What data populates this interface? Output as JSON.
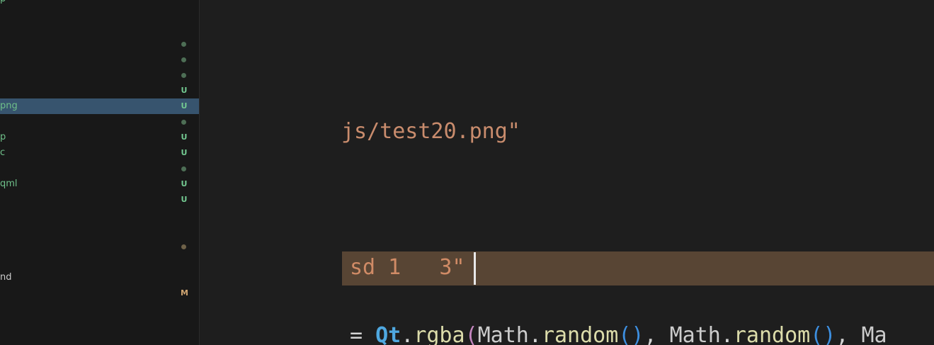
{
  "explorer": {
    "rows": [
      {
        "label": "p",
        "badge": "",
        "dot": "",
        "selected": false,
        "plain": false
      },
      {
        "label": "",
        "badge": "",
        "dot": "green",
        "selected": false,
        "plain": false
      },
      {
        "label": "",
        "badge": "",
        "dot": "green",
        "selected": false,
        "plain": false
      },
      {
        "label": "",
        "badge": "",
        "dot": "green",
        "selected": false,
        "plain": false
      },
      {
        "label": "",
        "badge": "U",
        "dot": "",
        "selected": false,
        "plain": false
      },
      {
        "label": "png",
        "badge": "U",
        "dot": "",
        "selected": true,
        "plain": false
      },
      {
        "label": "",
        "badge": "",
        "dot": "green",
        "selected": false,
        "plain": false
      },
      {
        "label": "p",
        "badge": "U",
        "dot": "",
        "selected": false,
        "plain": false
      },
      {
        "label": "c",
        "badge": "U",
        "dot": "",
        "selected": false,
        "plain": false
      },
      {
        "label": "",
        "badge": "",
        "dot": "green",
        "selected": false,
        "plain": false
      },
      {
        "label": "qml",
        "badge": "U",
        "dot": "",
        "selected": false,
        "plain": false
      },
      {
        "label": "",
        "badge": "U",
        "dot": "",
        "selected": false,
        "plain": false
      },
      {
        "label": "",
        "badge": "",
        "dot": "brown",
        "selected": false,
        "plain": false
      },
      {
        "label": "nd",
        "badge": "",
        "dot": "",
        "selected": false,
        "plain": true
      },
      {
        "label": "",
        "badge": "M",
        "dot": "",
        "selected": false,
        "plain": false
      }
    ]
  },
  "editor": {
    "line1": "js/test20.png\"",
    "line2": "sd 1   3\"",
    "line3_tokens": [
      {
        "text": "= ",
        "cls": "tok-op"
      },
      {
        "text": "Qt",
        "cls": "tok-obj"
      },
      {
        "text": ".",
        "cls": "tok-op"
      },
      {
        "text": "rgba",
        "cls": "tok-fn"
      },
      {
        "text": "(",
        "cls": "tok-paren1"
      },
      {
        "text": "Math",
        "cls": "tok-ident"
      },
      {
        "text": ".",
        "cls": "tok-op"
      },
      {
        "text": "random",
        "cls": "tok-fn"
      },
      {
        "text": "()",
        "cls": "tok-paren2"
      },
      {
        "text": ", ",
        "cls": "tok-op"
      },
      {
        "text": "Math",
        "cls": "tok-ident"
      },
      {
        "text": ".",
        "cls": "tok-op"
      },
      {
        "text": "random",
        "cls": "tok-fn"
      },
      {
        "text": "()",
        "cls": "tok-paren2"
      },
      {
        "text": ", ",
        "cls": "tok-op"
      },
      {
        "text": "Ma",
        "cls": "tok-ident"
      }
    ]
  }
}
